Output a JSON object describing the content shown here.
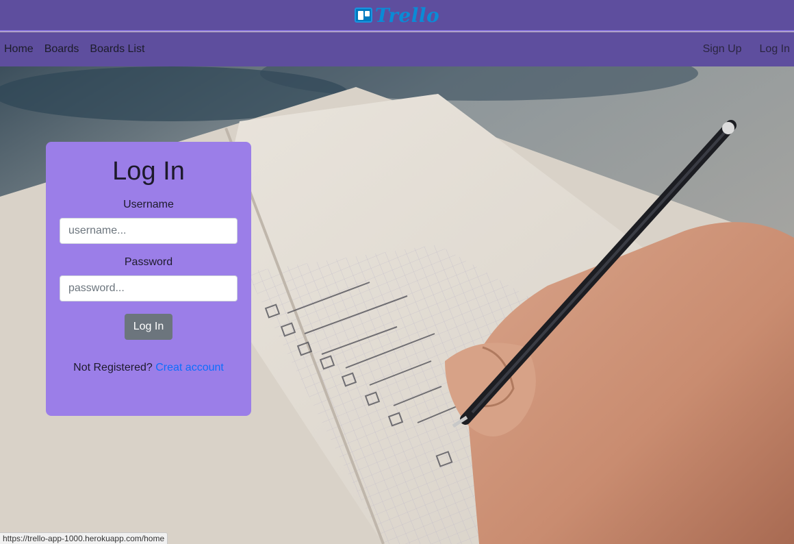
{
  "brand": {
    "logo_text": "Trello",
    "logo_icon": "trello-board-icon",
    "color": "#0079bf"
  },
  "nav": {
    "left": [
      {
        "label": "Home"
      },
      {
        "label": "Boards"
      },
      {
        "label": "Boards List"
      }
    ],
    "right": [
      {
        "label": "Sign Up"
      },
      {
        "label": "Log In"
      }
    ]
  },
  "login": {
    "title": "Log In",
    "username_label": "Username",
    "username_placeholder": "username...",
    "password_label": "Password",
    "password_placeholder": "password...",
    "submit_label": "Log In",
    "register_prompt": "Not Registered?",
    "register_link": "Creat account"
  },
  "status_bar": {
    "url": "https://trello-app-1000.herokuapp.com/home"
  },
  "colors": {
    "header_bg": "#5e4e9e",
    "card_bg": "#9b7ee8",
    "link": "#0d6efd",
    "button": "#6c757d"
  }
}
